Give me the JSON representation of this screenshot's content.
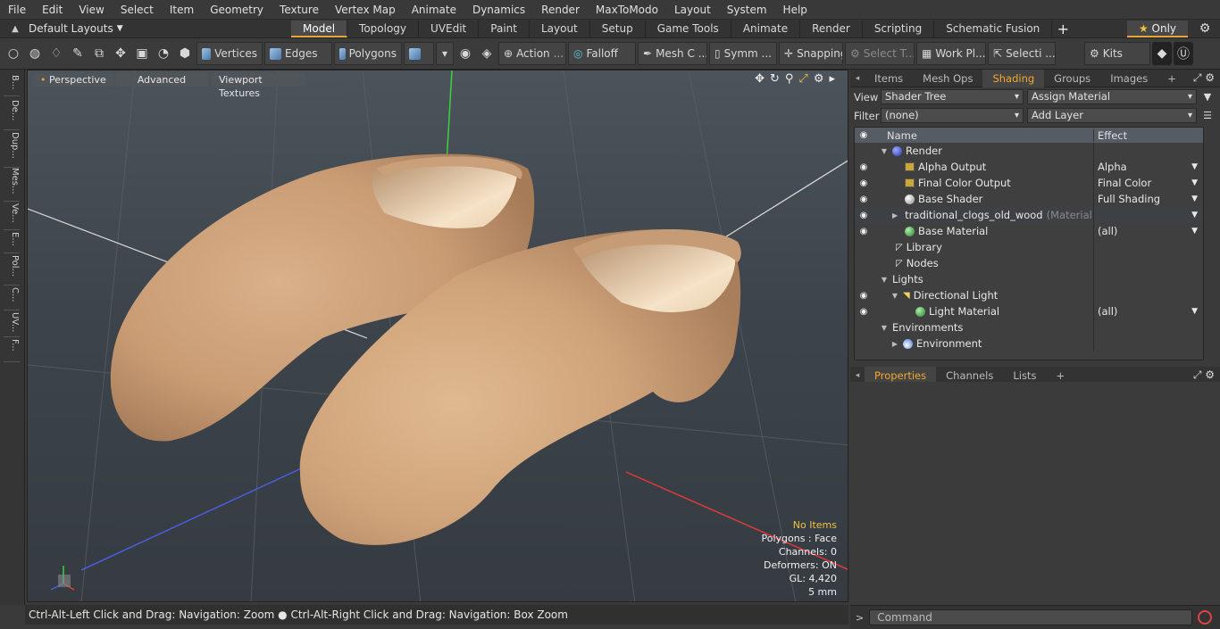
{
  "menu": [
    "File",
    "Edit",
    "View",
    "Select",
    "Item",
    "Geometry",
    "Texture",
    "Vertex Map",
    "Animate",
    "Dynamics",
    "Render",
    "MaxToModo",
    "Layout",
    "System",
    "Help"
  ],
  "layouts": {
    "dropdown": "Default Layouts",
    "tabs": [
      "Model",
      "Topology",
      "UVEdit",
      "Paint",
      "Layout",
      "Setup",
      "Game Tools",
      "Animate",
      "Render",
      "Scripting",
      "Schematic Fusion"
    ],
    "active_tab": "Model",
    "only_label": "Only"
  },
  "toolbar": {
    "vertices": "Vertices",
    "edges": "Edges",
    "polygons": "Polygons",
    "action": "Action",
    "falloff": "Falloff",
    "mesh": "Mesh C ...",
    "symm": "Symm ...",
    "snapping": "Snapping",
    "select_t": "Select T...",
    "work_pl": "Work Pl...",
    "selecti": "Selecti ...",
    "kits": "Kits"
  },
  "left_tabs": [
    "B...",
    "De...",
    "Dup...",
    "Mes...",
    "Ve...",
    "E...",
    "Pol...",
    "C...",
    "UV...",
    "F..."
  ],
  "viewport": {
    "perspective": "Perspective",
    "advanced": "Advanced",
    "viewport_textures": "Viewport Textures",
    "info": {
      "items": "No Items",
      "polygons": "Polygons : Face",
      "channels": "Channels: 0",
      "deformers": "Deformers: ON",
      "gl": "GL: 4,420",
      "units": "5 mm"
    }
  },
  "status": "Ctrl-Alt-Left Click and Drag: Navigation: Zoom ● Ctrl-Alt-Right Click and Drag: Navigation: Box Zoom",
  "panel_top": {
    "tabs": [
      "Items",
      "Mesh Ops",
      "Shading",
      "Groups",
      "Images"
    ],
    "active": "Shading",
    "view_label": "View",
    "view_value": "Shader Tree",
    "assign": "Assign Material",
    "filter_label": "Filter",
    "filter_value": "(none)",
    "add_layer": "Add Layer",
    "col_name": "Name",
    "col_effect": "Effect",
    "rows": [
      {
        "name": "Render",
        "effect": "",
        "suffix": ""
      },
      {
        "name": "Alpha Output",
        "effect": "Alpha",
        "suffix": ""
      },
      {
        "name": "Final Color Output",
        "effect": "Final Color",
        "suffix": ""
      },
      {
        "name": "Base Shader",
        "effect": "Full Shading",
        "suffix": ""
      },
      {
        "name": "traditional_clogs_old_wood",
        "effect": "",
        "suffix": "(Material)"
      },
      {
        "name": "Base Material",
        "effect": "(all)",
        "suffix": ""
      },
      {
        "name": "Library",
        "effect": "",
        "suffix": ""
      },
      {
        "name": "Nodes",
        "effect": "",
        "suffix": ""
      },
      {
        "name": "Lights",
        "effect": "",
        "suffix": ""
      },
      {
        "name": "Directional Light",
        "effect": "",
        "suffix": ""
      },
      {
        "name": "Light Material",
        "effect": "(all)",
        "suffix": ""
      },
      {
        "name": "Environments",
        "effect": "",
        "suffix": ""
      },
      {
        "name": "Environment",
        "effect": "",
        "suffix": ""
      }
    ]
  },
  "panel_bottom": {
    "tabs": [
      "Properties",
      "Channels",
      "Lists"
    ],
    "active": "Properties"
  },
  "command_placeholder": "Command"
}
